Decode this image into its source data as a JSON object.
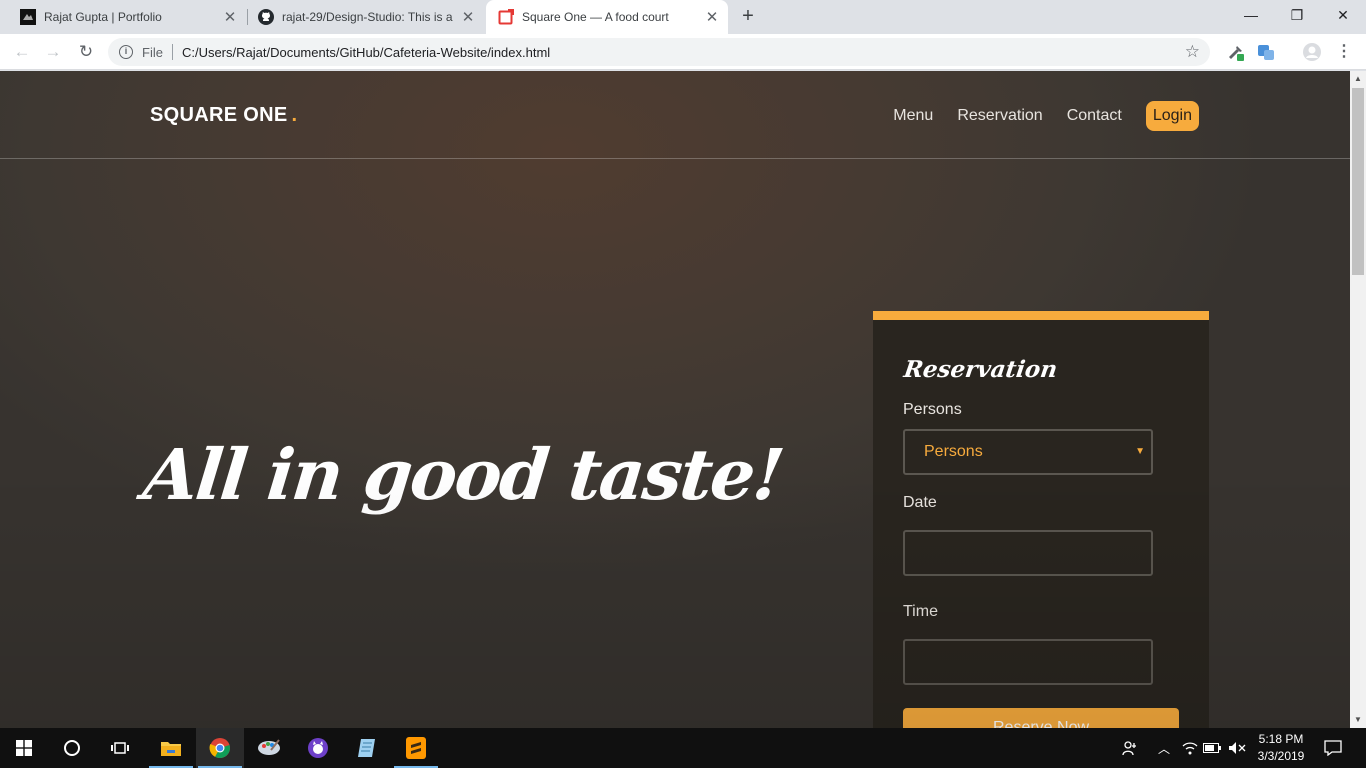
{
  "browser": {
    "tabs": [
      {
        "title": "Rajat Gupta | Portfolio",
        "icon": "portfolio-favicon",
        "active": false
      },
      {
        "title": "rajat-29/Design-Studio: This is a",
        "icon": "github-icon",
        "active": false
      },
      {
        "title": "Square One — A food court",
        "icon": "square-one-favicon",
        "active": true
      }
    ],
    "new_tab": "+",
    "window_controls": {
      "minimize": "—",
      "restore": "❐",
      "close": "✕"
    },
    "address": {
      "scheme_label": "File",
      "url": "C:/Users/Rajat/Documents/GitHub/Cafeteria-Website/index.html"
    }
  },
  "site": {
    "brand": "SQUARE ONE",
    "brand_dot": ".",
    "nav": {
      "menu": "Menu",
      "reservation": "Reservation",
      "contact": "Contact",
      "login": "Login"
    },
    "hero": "All in good taste!",
    "reservation": {
      "title": "Reservation",
      "persons_label": "Persons",
      "persons_selected": "Persons",
      "date_label": "Date",
      "time_label": "Time",
      "submit": "Reserve Now"
    },
    "accent_color": "#f7ab3d"
  },
  "taskbar": {
    "apps": [
      "windows-start",
      "cortana",
      "task-view",
      "file-explorer",
      "chrome",
      "paint",
      "github-desktop",
      "notepad",
      "sublime-text"
    ],
    "time": "5:18 PM",
    "date": "3/3/2019"
  }
}
